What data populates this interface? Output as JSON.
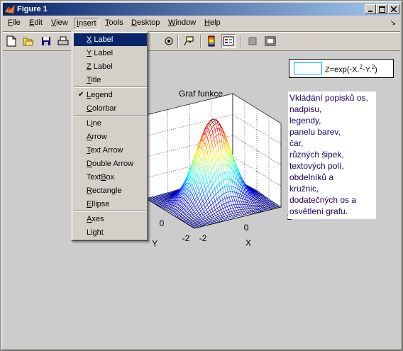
{
  "window": {
    "title": "Figure 1"
  },
  "menubar": {
    "items": [
      {
        "label": "File",
        "u": "F",
        "rest": "ile"
      },
      {
        "label": "Edit",
        "u": "E",
        "rest": "dit"
      },
      {
        "label": "View",
        "u": "V",
        "rest": "iew"
      },
      {
        "label": "Insert",
        "u": "I",
        "rest": "nsert"
      },
      {
        "label": "Tools",
        "u": "T",
        "rest": "ools"
      },
      {
        "label": "Desktop",
        "u": "D",
        "rest": "esktop"
      },
      {
        "label": "Window",
        "u": "W",
        "rest": "indow"
      },
      {
        "label": "Help",
        "u": "H",
        "rest": "elp"
      }
    ],
    "active": "Insert"
  },
  "insert_menu": {
    "items": [
      {
        "label": "X Label",
        "u": "X",
        "rest": " Label",
        "highlighted": true
      },
      {
        "label": "Y Label",
        "u": "Y",
        "rest": " Label"
      },
      {
        "label": "Z Label",
        "u": "Z",
        "rest": " Label"
      },
      {
        "label": "Title",
        "u": "T",
        "rest": "itle"
      },
      {
        "label": "Legend",
        "u": "L",
        "rest": "egend",
        "checked": true
      },
      {
        "label": "Colorbar",
        "u": "C",
        "rest": "olorbar"
      },
      {
        "label": "Line",
        "u": "i",
        "pre": "L",
        "rest": "ne"
      },
      {
        "label": "Arrow",
        "u": "A",
        "rest": "rrow"
      },
      {
        "label": "Text Arrow",
        "u": "T",
        "rest": "ext Arrow"
      },
      {
        "label": "Double Arrow",
        "u": "D",
        "rest": "ouble Arrow"
      },
      {
        "label": "TextBox",
        "u": "B",
        "pre": "Text",
        "rest": "ox"
      },
      {
        "label": "Rectangle",
        "u": "R",
        "rest": "ectangle"
      },
      {
        "label": "Ellipse",
        "u": "E",
        "rest": "llipse"
      },
      {
        "label": "Axes",
        "u": "A",
        "rest": "xes"
      },
      {
        "label": "Light",
        "u": "",
        "pre": "Light",
        "rest": ""
      }
    ]
  },
  "plot": {
    "title": "Graf funkce",
    "xlabel": "X",
    "ylabel": "Y",
    "x_ticks": [
      "-2",
      "0",
      "2"
    ],
    "y_ticks": [
      "-2",
      "0"
    ],
    "legend_text": "Z=exp(-X.",
    "legend_sup1": "2",
    "legend_mid": "-Y.",
    "legend_sup2": "2",
    "legend_end": ")"
  },
  "textbox": {
    "text": "Vkládání popisků os,\nnadpisu,\nlegendy,\npanelu barev,\nčar,\nrůzných šipek,\ntextových polí,\nobdelníků a\nkružnic,\ndodatečných os a\nosvětlení grafu."
  },
  "colors": {
    "titlebar_start": "#0a246a",
    "titlebar_end": "#a6caf0",
    "menu_highlight": "#0a246a",
    "figure_bg": "#cccccc"
  }
}
